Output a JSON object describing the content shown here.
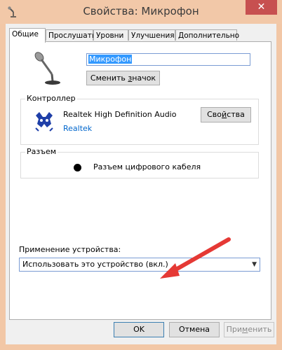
{
  "window": {
    "title": "Свойства: Микрофон",
    "close_label": "✕"
  },
  "tabs": [
    {
      "label": "Общие"
    },
    {
      "label": "Прослушать"
    },
    {
      "label": "Уровни"
    },
    {
      "label": "Улучшения"
    },
    {
      "label": "Дополнительно"
    }
  ],
  "general": {
    "device_name_value": "Микрофон",
    "change_icon_prefix": "Сменить ",
    "change_icon_underlined": "з",
    "change_icon_suffix": "начок"
  },
  "controller": {
    "group_label": "Контроллер",
    "name": "Realtek High Definition Audio",
    "vendor": "Realtek",
    "properties_prefix": "Сво",
    "properties_underlined": "й",
    "properties_suffix": "ства"
  },
  "jack": {
    "group_label": "Разъем",
    "label": "Разъем цифрового кабеля"
  },
  "usage": {
    "label": "Применение устройства:",
    "selected_value": "Использовать это устройство (вкл.)",
    "arrow": "▼"
  },
  "footer": {
    "ok_label": "OK",
    "cancel_label": "Отмена",
    "apply_prefix": "При",
    "apply_underlined": "м",
    "apply_suffix": "енить"
  },
  "colors": {
    "titlebar": "#f2c8a8",
    "close_button": "#c75050",
    "annotation_arrow": "#e53935",
    "selection": "#3399ff"
  }
}
